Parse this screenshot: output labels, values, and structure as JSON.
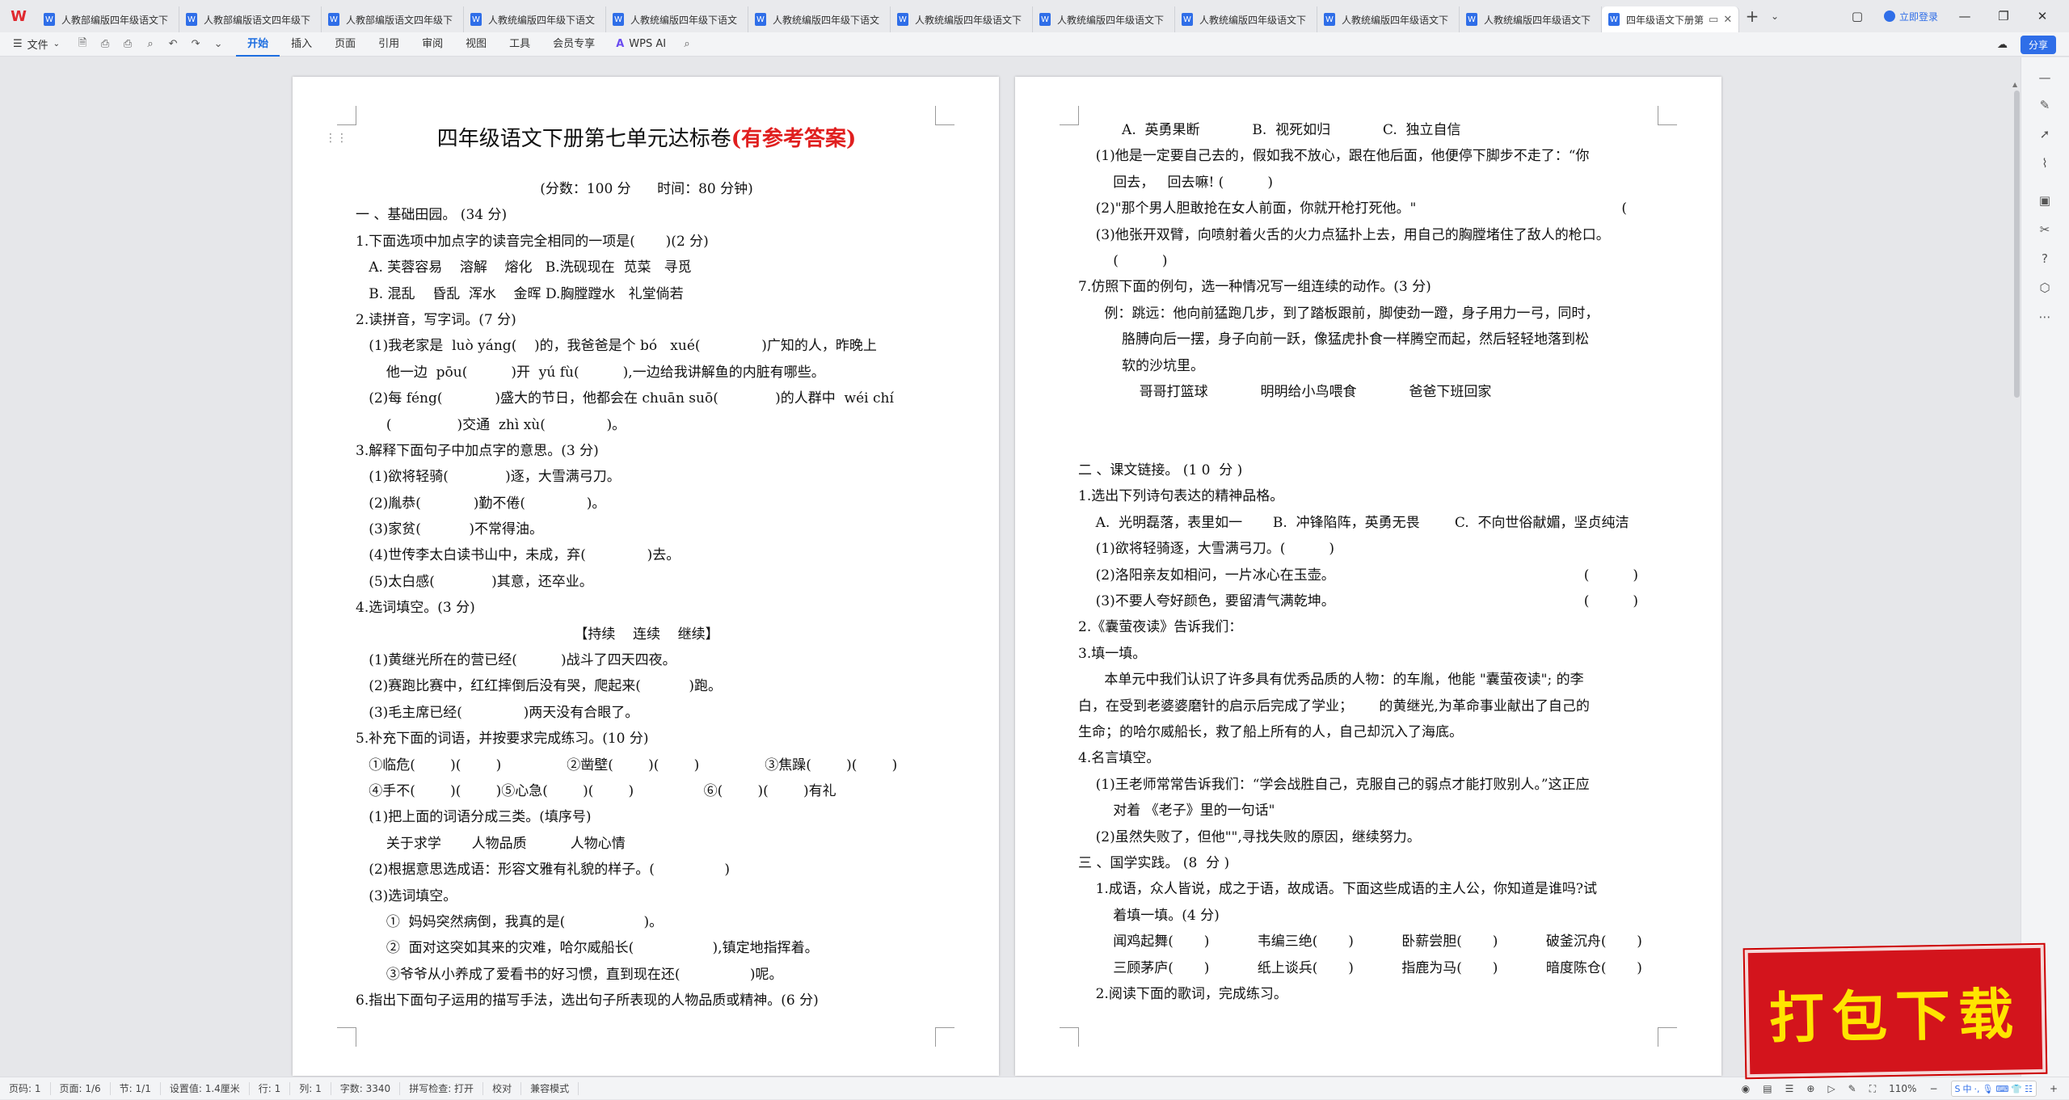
{
  "app": {
    "logo": "W",
    "tabs": [
      {
        "label": "人教部编版四年级语文下"
      },
      {
        "label": "人教部编版语文四年级下"
      },
      {
        "label": "人教部编版语文四年级下"
      },
      {
        "label": "人教统编版四年级下语文"
      },
      {
        "label": "人教统编版四年级下语文"
      },
      {
        "label": "人教统编版四年级下语文"
      },
      {
        "label": "人教统编版四年级语文下"
      },
      {
        "label": "人教统编版四年级语文下"
      },
      {
        "label": "人教统编版四年级语文下"
      },
      {
        "label": "人教统编版四年级语文下"
      },
      {
        "label": "人教统编版四年级语文下"
      }
    ],
    "active_tab": {
      "label": "四年级语文下册第"
    },
    "login_label": "立即登录",
    "share_label": "分享"
  },
  "menu": {
    "file_label": "文件",
    "ribbon_tabs": [
      "开始",
      "插入",
      "页面",
      "引用",
      "审阅",
      "视图",
      "工具",
      "会员专享"
    ],
    "active_ribbon_tab": "开始",
    "wps_ai_label": "WPS AI"
  },
  "left_page": {
    "title_main": "四年级语文下册第七单元达标卷",
    "title_red": "(有参考答案)",
    "lines": [
      "(分数：100 分      时间：80 分钟)",
      "一 、基础田园。 (34 分)",
      "1.下面选项中加点字的读音完全相同的一项是(       )(2 分)",
      "   A. 芙蓉容易    溶解    熔化   B.洗砚现在  苋菜   寻觅",
      "   B. 混乱    昏乱  浑水    金晖 D.胸膛蹚水   礼堂倘若",
      "2.读拼音，写字词。(7 分)",
      "   (1)我老家是  luò yáng(    )的，我爸爸是个 bó   xué(              )广知的人，昨晚上",
      "       他一边  pōu(          )开  yú fù(          ),一边给我讲解鱼的内脏有哪些。",
      "   (2)每 féng(            )盛大的节日，他都会在 chuān suō(             )的人群中  wéi chí",
      "       (               )交通  zhì xù(              )。",
      "3.解释下面句子中加点字的意思。(3 分)",
      "   (1)欲将轻骑(             )逐，大雪满弓刀。",
      "   (2)胤恭(            )勤不倦(              )。",
      "   (3)家贫(           )不常得油。",
      "   (4)世传李太白读书山中，未成，弃(              )去。",
      "   (5)太白感(             )其意，还卒业。",
      "4.选词填空。(3 分)",
      "【持续    连续    继续】",
      "   (1)黄继光所在的营已经(          )战斗了四天四夜。",
      "   (2)赛跑比赛中，红红摔倒后没有哭，爬起来(           )跑。",
      "   (3)毛主席已经(              )两天没有合眼了。",
      "5.补充下面的词语，并按要求完成练习。(10 分)",
      "   ①临危(        )(        )               ②凿壁(        )(        )               ③焦躁(        )(        )",
      "   ④手不(        )(        )⑤心急(        )(        )                ⑥(        )(        )有礼",
      "   (1)把上面的词语分成三类。(填序号)",
      "       关于求学       人物品质          人物心情",
      "   (2)根据意思选成语：形容文雅有礼貌的样子。(                )",
      "   (3)选词填空。",
      "       ①  妈妈突然病倒，我真的是(                  )。",
      "       ②  面对这突如其来的灾难，哈尔威船长(                  ),镇定地指挥着。",
      "       ③爷爷从小养成了爱看书的好习惯，直到现在还(                )呢。",
      "6.指出下面句子运用的描写手法，选出句子所表现的人物品质或精神。(6 分)"
    ]
  },
  "right_page": {
    "lines": [
      "          A.  英勇果断            B.  视死如归            C.  独立自信",
      "    (1)他是一定要自己去的，假如我不放心，跟在他后面，他便停下脚步不走了：“你",
      "        回去，   回去嘛! (          )",
      "    (2)\"那个男人胆敢抢在女人前面，你就开枪打死他。\"                                               (          )",
      "    (3)他张开双臂，向喷射着火舌的火力点猛扑上去，用自己的胸膛堵住了敌人的枪口。",
      "        (          )",
      "7.仿照下面的例句，选一种情况写一组连续的动作。(3 分)",
      "      例：跳远：他向前猛跑几步，到了踏板跟前，脚使劲一蹬，身子用力一弓，同时，",
      "          胳膊向后一摆，身子向前一跃，像猛虎扑食一样腾空而起，然后轻轻地落到松",
      "          软的沙坑里。",
      "              哥哥打篮球            明明给小鸟喂食            爸爸下班回家",
      "",
      "",
      "二 、课文链接。 (1 0  分 )",
      "1.选出下列诗句表达的精神品格。",
      "    A.  光明磊落，表里如一       B.  冲锋陷阵，英勇无畏        C.  不向世俗献媚，坚贞纯洁",
      "    (1)欲将轻骑逐，大雪满弓刀。(          )",
      "    (2)洛阳亲友如相问，一片冰心在玉壶。                                                         (          )",
      "    (3)不要人夸好颜色，要留清气满乾坤。                                                         (          )",
      "2.《囊萤夜读》告诉我们：",
      "3.填一填。",
      "      本单元中我们认识了许多具有优秀品质的人物：的车胤，他能 \"囊萤夜读\"; 的李",
      "白，在受到老婆婆磨针的启示后完成了学业；      的黄继光,为革命事业献出了自己的",
      "生命；的哈尔威船长，救了船上所有的人，自己却沉入了海底。",
      "4.名言填空。",
      "    (1)王老师常常告诉我们：“学会战胜自己，克服自己的弱点才能打败别人。”这正应",
      "        对着 《老子》里的一句话\"",
      "    (2)虽然失败了，但他\"\",寻找失败的原因，继续努力。",
      "三 、国学实践。 (8  分 )",
      "    1.成语，众人皆说，成之于语，故成语。下面这些成语的主人公，你知道是谁吗?试",
      "        着填一填。(4 分)",
      "        闻鸡起舞(       )           韦编三绝(       )           卧薪尝胆(       )           破釜沉舟(       )",
      "        三顾茅庐(       )           纸上谈兵(       )           指鹿为马(       )           暗度陈仓(       )",
      "    2.阅读下面的歌词，完成练习。"
    ]
  },
  "status": {
    "items": [
      "页码: 1",
      "页面: 1/6",
      "节: 1/1",
      "设置值: 1.4厘米",
      "行: 1",
      "列: 1",
      "字数: 3340",
      "拼写检查: 打开",
      "校对",
      "兼容模式"
    ],
    "zoom": "110%",
    "ime": [
      "S",
      "中",
      "·,",
      "🎙",
      "⌨",
      "👕",
      "☷"
    ]
  },
  "overlay": {
    "download_label": "打包下载"
  }
}
